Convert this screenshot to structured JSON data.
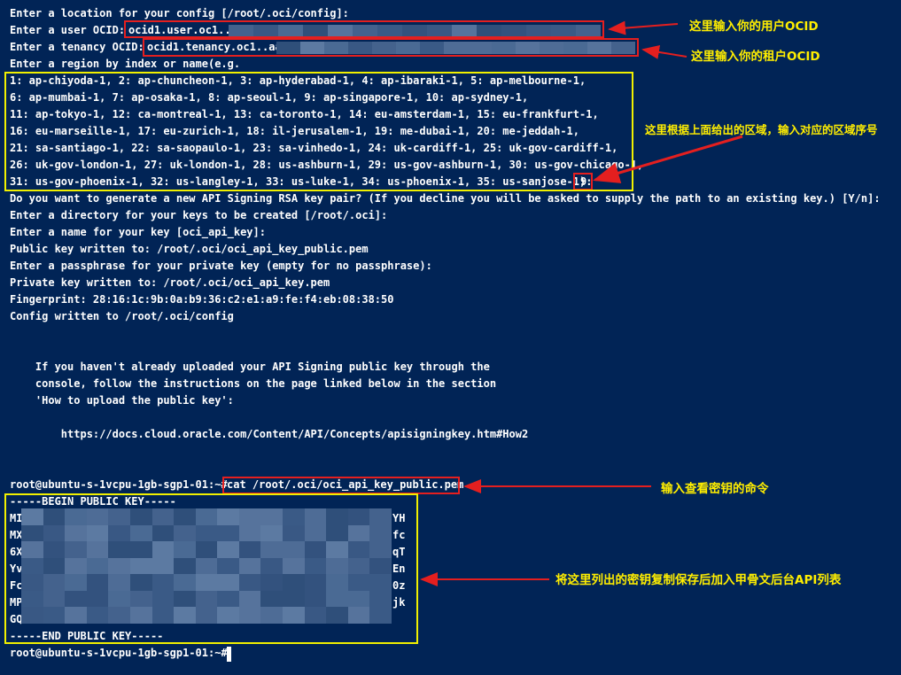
{
  "terminal": {
    "lines": [
      "Enter a location for your config [/root/.oci/config]:",
      "Enter a user OCID: ",
      "Enter a tenancy OCID: ",
      "Enter a region by index or name(e.g.",
      "1: ap-chiyoda-1, 2: ap-chuncheon-1, 3: ap-hyderabad-1, 4: ap-ibaraki-1, 5: ap-melbourne-1,",
      "6: ap-mumbai-1, 7: ap-osaka-1, 8: ap-seoul-1, 9: ap-singapore-1, 10: ap-sydney-1,",
      "11: ap-tokyo-1, 12: ca-montreal-1, 13: ca-toronto-1, 14: eu-amsterdam-1, 15: eu-frankfurt-1,",
      "16: eu-marseille-1, 17: eu-zurich-1, 18: il-jerusalem-1, 19: me-dubai-1, 20: me-jeddah-1,",
      "21: sa-santiago-1, 22: sa-saopaulo-1, 23: sa-vinhedo-1, 24: uk-cardiff-1, 25: uk-gov-cardiff-1,",
      "26: uk-gov-london-1, 27: uk-london-1, 28: us-ashburn-1, 29: us-gov-ashburn-1, 30: us-gov-chicago-1,",
      "31: us-gov-phoenix-1, 32: us-langley-1, 33: us-luke-1, 34: us-phoenix-1, 35: us-sanjose-1): ",
      "Do you want to generate a new API Signing RSA key pair? (If you decline you will be asked to supply the path to an existing key.) [Y/n]:",
      "Enter a directory for your keys to be created [/root/.oci]:",
      "Enter a name for your key [oci_api_key]:",
      "Public key written to: /root/.oci/oci_api_key_public.pem",
      "Enter a passphrase for your private key (empty for no passphrase):",
      "Private key written to: /root/.oci/oci_api_key.pem",
      "Fingerprint: 28:16:1c:9b:0a:b9:36:c2:e1:a9:fe:f4:eb:08:38:50",
      "Config written to /root/.oci/config",
      "    If you haven't already uploaded your API Signing public key through the",
      "    console, follow the instructions on the page linked below in the section",
      "    'How to upload the public key':",
      "        https://docs.cloud.oracle.com/Content/API/Concepts/apisigningkey.htm#How2",
      "root@ubuntu-s-1vcpu-1gb-sgp1-01:~# ",
      "-----BEGIN PUBLIC KEY-----",
      "MI",
      "MX",
      "6X",
      "Yv",
      "Fc",
      "MP",
      "GQ",
      "-----END PUBLIC KEY-----",
      "root@ubuntu-s-1vcpu-1gb-sgp1-01:~# "
    ],
    "user_ocid": "ocid1.user.oc1..aa",
    "tenancy_ocid": "ocid1.tenancy.oc1..aa",
    "region_choice": "9",
    "cat_command": "cat /root/.oci/oci_api_key_public.pem",
    "key_right_edges": [
      "YH",
      "fc",
      "qT",
      "En",
      "0z",
      "jk"
    ]
  },
  "annotations": {
    "user_ocid_note": "这里输入你的用户OCID",
    "tenancy_ocid_note": "这里输入你的租户OCID",
    "region_note": "这里根据上面给出的区域，输入对应的区域序号",
    "cat_note": "输入查看密钥的命令",
    "key_note": "将这里列出的密钥复制保存后加入甲骨文后台API列表"
  },
  "colors": {
    "background": "#012456",
    "text": "#ffffff",
    "annotation": "#ffee00",
    "red_box": "#e41f1f",
    "yellow_box": "#f0f000"
  }
}
